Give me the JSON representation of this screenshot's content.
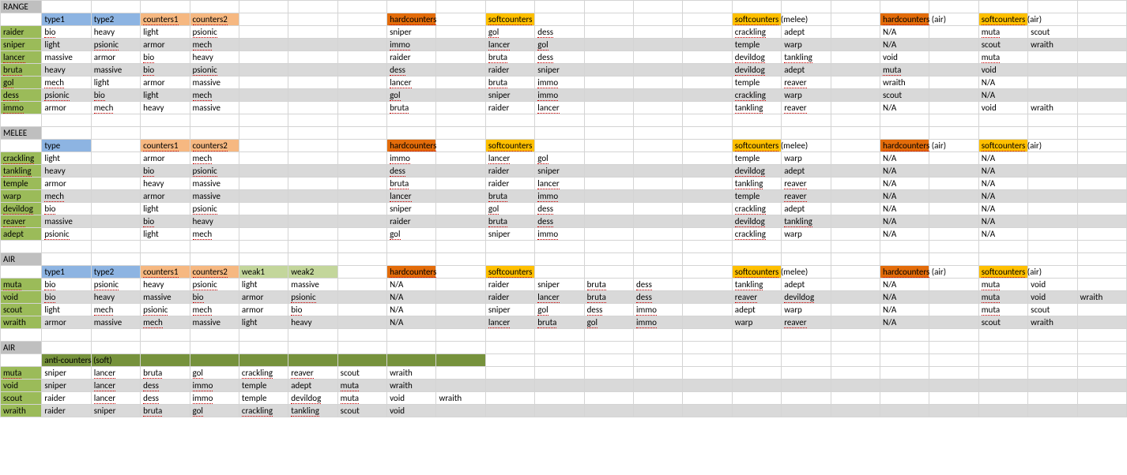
{
  "sections": [
    {
      "title": "RANGE",
      "headers": [
        {
          "col": 1,
          "text": "type1",
          "cls": "bg-blue"
        },
        {
          "col": 2,
          "text": "type2",
          "cls": "bg-blue"
        },
        {
          "col": 3,
          "text": "counters1",
          "cls": "bg-orange"
        },
        {
          "col": 4,
          "text": "counters2",
          "cls": "bg-orange"
        },
        {
          "col": 8,
          "text": "hardcounters",
          "cls": "bg-dkorange"
        },
        {
          "col": 10,
          "text": "softcounters",
          "cls": "bg-yellow"
        },
        {
          "col": 15,
          "text": "softcounters (melee)",
          "cls": "bg-yellow"
        },
        {
          "col": 18,
          "text": "hardcounters (air)",
          "cls": "bg-dkorange"
        },
        {
          "col": 20,
          "text": "softcounters (air)",
          "cls": "bg-yellow"
        }
      ],
      "rows": [
        {
          "name": "raider",
          "alt": false,
          "cells": {
            "1": "bio",
            "2": "heavy",
            "3": "light",
            "4": "psionic",
            "8": "sniper",
            "10": "gol",
            "11": "dess",
            "15": "crackling",
            "16": "adept",
            "18": "N/A",
            "20": "muta",
            "21": "scout"
          }
        },
        {
          "name": "sniper",
          "alt": true,
          "cells": {
            "1": "light",
            "2": "psionic",
            "3": "armor",
            "4": "mech",
            "8": "immo",
            "10": "lancer",
            "11": "gol",
            "15": "temple",
            "16": "warp",
            "18": "N/A",
            "20": "scout",
            "21": "wraith"
          }
        },
        {
          "name": "lancer",
          "alt": false,
          "cells": {
            "1": "massive",
            "2": "armor",
            "3": "bio",
            "4": "heavy",
            "8": "raider",
            "10": "bruta",
            "11": "dess",
            "15": "devildog",
            "16": "tankling",
            "18": "void",
            "20": "muta"
          }
        },
        {
          "name": "bruta",
          "alt": true,
          "cells": {
            "1": "heavy",
            "2": "massive",
            "3": "bio",
            "4": "psionic",
            "8": "dess",
            "10": "raider",
            "11": "sniper",
            "15": "devildog",
            "16": "adept",
            "18": "muta",
            "20": "void"
          }
        },
        {
          "name": "gol",
          "alt": false,
          "cells": {
            "1": "mech",
            "2": "light",
            "3": "armor",
            "4": "massive",
            "8": "lancer",
            "10": "bruta",
            "11": "immo",
            "15": "temple",
            "16": "reaver",
            "18": "wraith",
            "20": "N/A"
          }
        },
        {
          "name": "dess",
          "alt": true,
          "cells": {
            "1": "psionic",
            "2": "bio",
            "3": "light",
            "4": "mech",
            "8": "gol",
            "10": "sniper",
            "11": "immo",
            "15": "crackling",
            "16": "warp",
            "18": "scout",
            "20": "N/A"
          }
        },
        {
          "name": "immo",
          "alt": false,
          "cells": {
            "1": "armor",
            "2": "mech",
            "3": "heavy",
            "4": "massive",
            "8": "bruta",
            "10": "raider",
            "11": "lancer",
            "15": "tankling",
            "16": "reaver",
            "18": "N/A",
            "20": "void",
            "21": "wraith"
          }
        }
      ]
    },
    {
      "title": "MELEE",
      "headers": [
        {
          "col": 1,
          "text": "type",
          "cls": "bg-blue"
        },
        {
          "col": 3,
          "text": "counters1",
          "cls": "bg-orange"
        },
        {
          "col": 4,
          "text": "counters2",
          "cls": "bg-orange"
        },
        {
          "col": 8,
          "text": "hardcounters",
          "cls": "bg-dkorange"
        },
        {
          "col": 10,
          "text": "softcounters",
          "cls": "bg-yellow"
        },
        {
          "col": 15,
          "text": "softcounters (melee)",
          "cls": "bg-yellow"
        },
        {
          "col": 18,
          "text": "hardcounters (air)",
          "cls": "bg-dkorange"
        },
        {
          "col": 20,
          "text": "softcounters (air)",
          "cls": "bg-yellow"
        }
      ],
      "rows": [
        {
          "name": "crackling",
          "alt": false,
          "cells": {
            "1": "light",
            "3": "armor",
            "4": "mech",
            "8": "immo",
            "10": "lancer",
            "11": "gol",
            "15": "temple",
            "16": "warp",
            "18": "N/A",
            "20": "N/A"
          }
        },
        {
          "name": "tankling",
          "alt": true,
          "cells": {
            "1": "heavy",
            "3": "bio",
            "4": "psionic",
            "8": "dess",
            "10": "raider",
            "11": "sniper",
            "15": "devildog",
            "16": "adept",
            "18": "N/A",
            "20": "N/A"
          }
        },
        {
          "name": "temple",
          "alt": false,
          "cells": {
            "1": "armor",
            "3": "heavy",
            "4": "massive",
            "8": "bruta",
            "10": "raider",
            "11": "lancer",
            "15": "tankling",
            "16": "reaver",
            "18": "N/A",
            "20": "N/A"
          }
        },
        {
          "name": "warp",
          "alt": true,
          "cells": {
            "1": "mech",
            "3": "armor",
            "4": "massive",
            "8": "lancer",
            "10": "bruta",
            "11": "immo",
            "15": "temple",
            "16": "reaver",
            "18": "N/A",
            "20": "N/A"
          }
        },
        {
          "name": "devildog",
          "alt": false,
          "cells": {
            "1": "bio",
            "3": "light",
            "4": "psionic",
            "8": "sniper",
            "10": "gol",
            "11": "dess",
            "15": "crackling",
            "16": "adept",
            "18": "N/A",
            "20": "N/A"
          }
        },
        {
          "name": "reaver",
          "alt": true,
          "cells": {
            "1": "massive",
            "3": "bio",
            "4": "heavy",
            "8": "raider",
            "10": "bruta",
            "11": "dess",
            "15": "devildog",
            "16": "tankling",
            "18": "N/A",
            "20": "N/A"
          }
        },
        {
          "name": "adept",
          "alt": false,
          "cells": {
            "1": "psionic",
            "3": "light",
            "4": "mech",
            "8": "gol",
            "10": "sniper",
            "11": "immo",
            "15": "crackling",
            "16": "warp",
            "18": "N/A",
            "20": "N/A"
          }
        }
      ]
    },
    {
      "title": "AIR",
      "headers": [
        {
          "col": 1,
          "text": "type1",
          "cls": "bg-blue"
        },
        {
          "col": 2,
          "text": "type2",
          "cls": "bg-blue"
        },
        {
          "col": 3,
          "text": "counters1",
          "cls": "bg-orange"
        },
        {
          "col": 4,
          "text": "counters2",
          "cls": "bg-orange"
        },
        {
          "col": 5,
          "text": "weak1",
          "cls": "bg-green2"
        },
        {
          "col": 6,
          "text": "weak2",
          "cls": "bg-green2"
        },
        {
          "col": 8,
          "text": "hardcounters",
          "cls": "bg-dkorange"
        },
        {
          "col": 10,
          "text": "softcounters",
          "cls": "bg-yellow"
        },
        {
          "col": 15,
          "text": "softcounters (melee)",
          "cls": "bg-yellow"
        },
        {
          "col": 18,
          "text": "hardcounters (air)",
          "cls": "bg-dkorange"
        },
        {
          "col": 20,
          "text": "softcounters (air)",
          "cls": "bg-yellow"
        }
      ],
      "rows": [
        {
          "name": "muta",
          "alt": false,
          "cells": {
            "1": "bio",
            "2": "psionic",
            "3": "heavy",
            "4": "psionic",
            "5": "light",
            "6": "massive",
            "8": "N/A",
            "10": "raider",
            "11": "sniper",
            "12": "bruta",
            "13": "dess",
            "15": "tankling",
            "16": "adept",
            "18": "N/A",
            "20": "muta",
            "21": "void"
          }
        },
        {
          "name": "void",
          "alt": true,
          "cells": {
            "1": "bio",
            "2": "heavy",
            "3": "massive",
            "4": "bio",
            "5": "armor",
            "6": "psionic",
            "8": "N/A",
            "10": "raider",
            "11": "lancer",
            "12": "bruta",
            "13": "dess",
            "15": "reaver",
            "16": "devildog",
            "18": "N/A",
            "20": "muta",
            "21": "void",
            "22": "wraith"
          }
        },
        {
          "name": "scout",
          "alt": false,
          "cells": {
            "1": "light",
            "2": "mech",
            "3": "psionic",
            "4": "mech",
            "5": "armor",
            "6": "bio",
            "8": "N/A",
            "10": "sniper",
            "11": "gol",
            "12": "dess",
            "13": "immo",
            "15": "adept",
            "16": "warp",
            "18": "N/A",
            "20": "muta",
            "21": "scout"
          }
        },
        {
          "name": "wraith",
          "alt": true,
          "cells": {
            "1": "armor",
            "2": "massive",
            "3": "mech",
            "4": "massive",
            "5": "light",
            "6": "heavy",
            "8": "N/A",
            "10": "lancer",
            "11": "bruta",
            "12": "gol",
            "13": "immo",
            "15": "warp",
            "16": "reaver",
            "18": "N/A",
            "20": "scout",
            "21": "wraith"
          }
        }
      ]
    }
  ],
  "airAnti": {
    "title": "AIR",
    "header": "anti-counters (soft)",
    "rows": [
      {
        "name": "muta",
        "alt": false,
        "cells": {
          "1": "sniper",
          "2": "lancer",
          "3": "bruta",
          "4": "gol",
          "5": "crackling",
          "6": "reaver",
          "7": "scout",
          "8": "wraith"
        }
      },
      {
        "name": "void",
        "alt": true,
        "cells": {
          "1": "sniper",
          "2": "lancer",
          "3": "dess",
          "4": "immo",
          "5": "temple",
          "6": "adept",
          "7": "muta",
          "8": "wraith"
        }
      },
      {
        "name": "scout",
        "alt": false,
        "cells": {
          "1": "raider",
          "2": "lancer",
          "3": "dess",
          "4": "immo",
          "5": "temple",
          "6": "devildog",
          "7": "muta",
          "8": "void",
          "9": "wraith"
        }
      },
      {
        "name": "wraith",
        "alt": true,
        "cells": {
          "1": "raider",
          "2": "sniper",
          "3": "bruta",
          "4": "gol",
          "5": "crackling",
          "6": "tankling",
          "7": "scout",
          "8": "void"
        }
      }
    ]
  }
}
